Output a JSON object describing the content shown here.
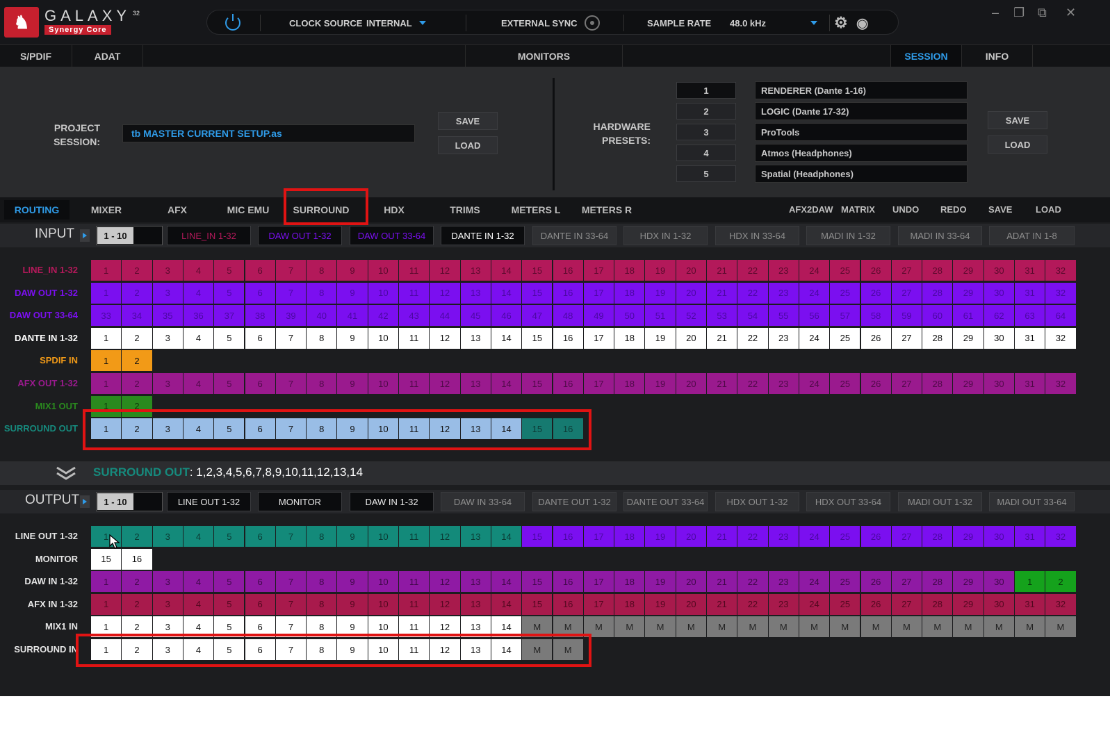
{
  "app": {
    "logo_title": "GALAXY",
    "logo_sup": "32",
    "logo_sub": "Synergy Core"
  },
  "topbar": {
    "clock_label": "CLOCK SOURCE",
    "clock_value": "INTERNAL",
    "ext_sync_label": "EXTERNAL SYNC",
    "sample_rate_label": "SAMPLE RATE",
    "sample_rate_value": "48.0 kHz"
  },
  "window_controls": {
    "minimize": "–",
    "restore": "❐",
    "maximize": "⧉",
    "close": "✕"
  },
  "tabs": [
    "S/PDIF",
    "ADAT",
    "MONITORS",
    "SESSION",
    "INFO"
  ],
  "session": {
    "project_label_1": "PROJECT",
    "project_label_2": "SESSION:",
    "project_value": "tb MASTER CURRENT SETUP.as",
    "save": "SAVE",
    "load": "LOAD",
    "hw_label_1": "HARDWARE",
    "hw_label_2": "PRESETS:",
    "presets": [
      {
        "num": "1",
        "name": "RENDERER (Dante 1-16)"
      },
      {
        "num": "2",
        "name": "LOGIC (Dante 17-32)"
      },
      {
        "num": "3",
        "name": "ProTools"
      },
      {
        "num": "4",
        "name": "Atmos (Headphones)"
      },
      {
        "num": "5",
        "name": "Spatial (Headphones)"
      }
    ],
    "hw_save": "SAVE",
    "hw_load": "LOAD"
  },
  "route_tabs": [
    "ROUTING",
    "MIXER",
    "AFX",
    "MIC EMU",
    "SURROUND",
    "HDX",
    "TRIMS",
    "METERS L",
    "METERS R"
  ],
  "route_actions": [
    "AFX2DAW",
    "MATRIX",
    "UNDO",
    "REDO",
    "SAVE",
    "LOAD"
  ],
  "input": {
    "label": "INPUT",
    "range": "1 - 10",
    "tabs": [
      "LINE_IN 1-32",
      "DAW OUT 1-32",
      "DAW OUT 33-64",
      "DANTE IN 1-32",
      "DANTE IN 33-64",
      "HDX IN 1-32",
      "HDX IN 33-64",
      "MADI IN 1-32",
      "MADI IN 33-64",
      "ADAT IN 1-8"
    ],
    "tab_colors": [
      "#b3195a",
      "#7b0ff0",
      "#7b0ff0",
      "#ffffff",
      "#8e8e8e",
      "#8e8e8e",
      "#8e8e8e",
      "#8e8e8e",
      "#8e8e8e",
      "#8e8e8e"
    ],
    "rows": [
      {
        "label": "LINE_IN 1-32",
        "label_color": "#b3195a"
      },
      {
        "label": "DAW OUT 1-32",
        "label_color": "#7b0ff0"
      },
      {
        "label": "DAW OUT 33-64",
        "label_color": "#7b0ff0"
      },
      {
        "label": "DANTE IN 1-32",
        "label_color": "#ffffff"
      },
      {
        "label": "SPDIF IN",
        "label_color": "#f29a17"
      },
      {
        "label": "AFX OUT 1-32",
        "label_color": "#9a1a8e"
      },
      {
        "label": "MIX1 OUT",
        "label_color": "#2a8a1e"
      },
      {
        "label": "SURROUND OUT",
        "label_color": "#168a7d"
      }
    ]
  },
  "summary": {
    "name": "SURROUND OUT",
    "channels": ": 1,2,3,4,5,6,7,8,9,10,11,12,13,14"
  },
  "output": {
    "label": "OUTPUT",
    "range": "1 - 10",
    "tabs": [
      "LINE OUT 1-32",
      "MONITOR",
      "DAW IN 1-32",
      "DAW IN 33-64",
      "DANTE OUT 1-32",
      "DANTE OUT 33-64",
      "HDX OUT 1-32",
      "HDX OUT 33-64",
      "MADI OUT 1-32",
      "MADI OUT 33-64"
    ],
    "rows": [
      {
        "label": "LINE OUT 1-32"
      },
      {
        "label": "MONITOR"
      },
      {
        "label": "DAW IN 1-32"
      },
      {
        "label": "AFX IN 1-32"
      },
      {
        "label": "MIX1 IN"
      },
      {
        "label": "SURROUND IN"
      }
    ]
  },
  "grids": {
    "input": [
      {
        "cells": [
          "1",
          "2",
          "3",
          "4",
          "5",
          "6",
          "7",
          "8",
          "9",
          "10",
          "11",
          "12",
          "13",
          "14",
          "15",
          "16",
          "17",
          "18",
          "19",
          "20",
          "21",
          "22",
          "23",
          "24",
          "25",
          "26",
          "27",
          "28",
          "29",
          "30",
          "31",
          "32"
        ],
        "cls": "c-line"
      },
      {
        "cells": [
          "1",
          "2",
          "3",
          "4",
          "5",
          "6",
          "7",
          "8",
          "9",
          "10",
          "11",
          "12",
          "13",
          "14",
          "15",
          "16",
          "17",
          "18",
          "19",
          "20",
          "21",
          "22",
          "23",
          "24",
          "25",
          "26",
          "27",
          "28",
          "29",
          "30",
          "31",
          "32"
        ],
        "cls": "c-daw"
      },
      {
        "cells": [
          "33",
          "34",
          "35",
          "36",
          "37",
          "38",
          "39",
          "40",
          "41",
          "42",
          "43",
          "44",
          "45",
          "46",
          "47",
          "48",
          "49",
          "50",
          "51",
          "52",
          "53",
          "54",
          "55",
          "56",
          "57",
          "58",
          "59",
          "60",
          "61",
          "62",
          "63",
          "64"
        ],
        "cls": "c-daw"
      },
      {
        "cells": [
          "1",
          "2",
          "3",
          "4",
          "5",
          "6",
          "7",
          "8",
          "9",
          "10",
          "11",
          "12",
          "13",
          "14",
          "15",
          "16",
          "17",
          "18",
          "19",
          "20",
          "21",
          "22",
          "23",
          "24",
          "25",
          "26",
          "27",
          "28",
          "29",
          "30",
          "31",
          "32"
        ],
        "cls": "c-white"
      },
      {
        "cells": [
          "1",
          "2"
        ],
        "cls": "c-orange"
      },
      {
        "cells": [
          "1",
          "2",
          "3",
          "4",
          "5",
          "6",
          "7",
          "8",
          "9",
          "10",
          "11",
          "12",
          "13",
          "14",
          "15",
          "16",
          "17",
          "18",
          "19",
          "20",
          "21",
          "22",
          "23",
          "24",
          "25",
          "26",
          "27",
          "28",
          "29",
          "30",
          "31",
          "32"
        ],
        "cls": "c-afx"
      },
      {
        "cells": [
          "1",
          "2"
        ],
        "cls": "c-green"
      },
      {
        "cells": [
          "1",
          "2",
          "3",
          "4",
          "5",
          "6",
          "7",
          "8",
          "9",
          "10",
          "11",
          "12",
          "13",
          "14",
          "15",
          "16"
        ],
        "cls": "c-sblue",
        "alt_from": 14,
        "alt_cls": "c-teal"
      }
    ],
    "output": [
      {
        "cells": [
          "1",
          "2",
          "3",
          "4",
          "5",
          "6",
          "7",
          "8",
          "9",
          "10",
          "11",
          "12",
          "13",
          "14",
          "15",
          "16",
          "17",
          "18",
          "19",
          "20",
          "21",
          "22",
          "23",
          "24",
          "25",
          "26",
          "27",
          "28",
          "29",
          "30",
          "31",
          "32"
        ],
        "cls": "c-teal2",
        "alt_from": 14,
        "alt_cls": "c-daw"
      },
      {
        "cells": [
          "15",
          "16"
        ],
        "cls": "c-white"
      },
      {
        "cells": [
          "1",
          "2",
          "3",
          "4",
          "5",
          "6",
          "7",
          "8",
          "9",
          "10",
          "11",
          "12",
          "13",
          "14",
          "15",
          "16",
          "17",
          "18",
          "19",
          "20",
          "21",
          "22",
          "23",
          "24",
          "25",
          "26",
          "27",
          "28",
          "29",
          "30",
          "1",
          "2"
        ],
        "cls": "c-dawin",
        "alt_from": 30,
        "alt_cls": "c-green2"
      },
      {
        "cells": [
          "1",
          "2",
          "3",
          "4",
          "5",
          "6",
          "7",
          "8",
          "9",
          "10",
          "11",
          "12",
          "13",
          "14",
          "15",
          "16",
          "17",
          "18",
          "19",
          "20",
          "21",
          "22",
          "23",
          "24",
          "25",
          "26",
          "27",
          "28",
          "29",
          "30",
          "31",
          "32"
        ],
        "cls": "c-afxin"
      },
      {
        "cells": [
          "1",
          "2",
          "3",
          "4",
          "5",
          "6",
          "7",
          "8",
          "9",
          "10",
          "11",
          "12",
          "13",
          "14",
          "M",
          "M",
          "M",
          "M",
          "M",
          "M",
          "M",
          "M",
          "M",
          "M",
          "M",
          "M",
          "M",
          "M",
          "M",
          "M",
          "M",
          "M"
        ],
        "cls": "c-white",
        "alt_from": 14,
        "alt_cls": "c-grey"
      },
      {
        "cells": [
          "1",
          "2",
          "3",
          "4",
          "5",
          "6",
          "7",
          "8",
          "9",
          "10",
          "11",
          "12",
          "13",
          "14",
          "M",
          "M"
        ],
        "cls": "c-white",
        "alt_from": 14,
        "alt_cls": "c-grey"
      }
    ]
  }
}
